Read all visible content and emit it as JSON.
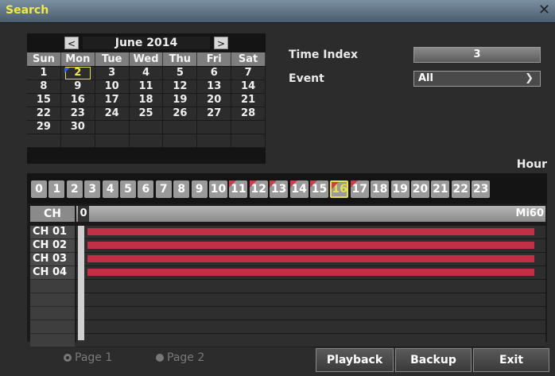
{
  "window": {
    "title": "Search",
    "close_icon": "close-icon"
  },
  "calendar": {
    "month_label": "June 2014",
    "prev_label": "<",
    "next_label": ">",
    "days": [
      "Sun",
      "Mon",
      "Tue",
      "Wed",
      "Thu",
      "Fri",
      "Sat"
    ],
    "weeks": [
      [
        "1",
        "2",
        "3",
        "4",
        "5",
        "6",
        "7"
      ],
      [
        "8",
        "9",
        "10",
        "11",
        "12",
        "13",
        "14"
      ],
      [
        "15",
        "16",
        "17",
        "18",
        "19",
        "20",
        "21"
      ],
      [
        "22",
        "23",
        "24",
        "25",
        "26",
        "27",
        "28"
      ],
      [
        "29",
        "30",
        "",
        "",
        "",
        "",
        ""
      ],
      [
        "",
        "",
        "",
        "",
        "",
        "",
        ""
      ]
    ],
    "selected_day": "2"
  },
  "controls": {
    "time_index_label": "Time Index",
    "time_index_value": "3",
    "event_label": "Event",
    "event_value": "All",
    "hour_label": "Hour"
  },
  "hours": [
    "0",
    "1",
    "2",
    "3",
    "4",
    "5",
    "6",
    "7",
    "8",
    "9",
    "10",
    "11",
    "12",
    "13",
    "14",
    "15",
    "16",
    "17",
    "18",
    "19",
    "20",
    "21",
    "22",
    "23"
  ],
  "hours_with_recording": [
    "11",
    "12",
    "13",
    "14",
    "15",
    "16",
    "17"
  ],
  "current_hour": "16",
  "channels": {
    "header": "CH",
    "scale_start": "0",
    "scale_end": "Mi60",
    "rows": [
      "CH 01",
      "CH 02",
      "CH 03",
      "CH 04"
    ],
    "recording_color": "#c23048"
  },
  "footer": {
    "page1": "Page 1",
    "page2": "Page 2",
    "playback": "Playback",
    "backup": "Backup",
    "exit": "Exit"
  }
}
